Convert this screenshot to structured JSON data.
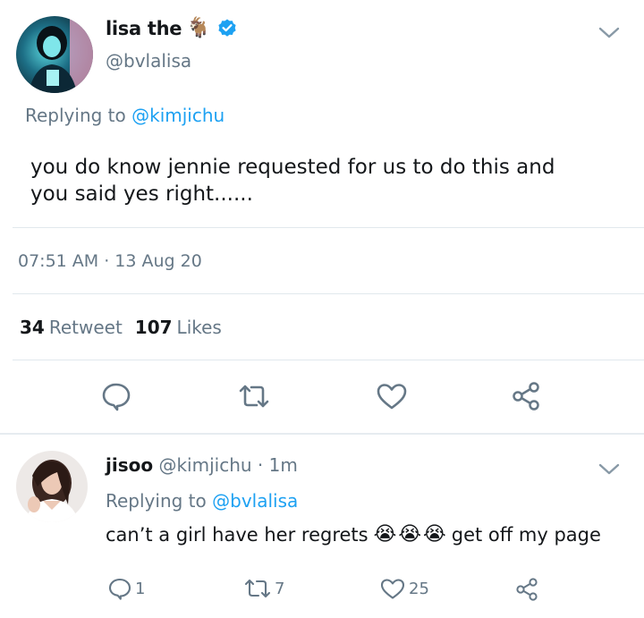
{
  "main_tweet": {
    "display_name": "lisa the",
    "name_emoji": "🐐",
    "handle": "@bvlalisa",
    "replying_prefix": "Replying to",
    "replying_handle": "@kimjichu",
    "text_line1": "you do know jennie requested for us to do this and",
    "text_line2": "you said yes right......",
    "timestamp": "07:51 AM · 13 Aug 20",
    "retweet_count": "34",
    "retweet_label": "Retweet",
    "likes_count": "107",
    "likes_label": "Likes",
    "icons": [
      "reply-icon",
      "retweet-icon",
      "like-icon",
      "share-icon"
    ]
  },
  "reply": {
    "display_name": "jisoo",
    "handle": "@kimjichu",
    "time": "· 1m",
    "replying_prefix": "Replying to",
    "replying_handle": "@bvlalisa",
    "text_before": "can’t a girl have her regrets",
    "emojis": [
      "😭",
      "😭",
      "😭"
    ],
    "text_after": "get off my page",
    "reply_count": "1",
    "retweet_count": "7",
    "like_count": "25"
  },
  "colors": {
    "link": "#1da1f2",
    "secondary_text": "#657786",
    "primary_text": "#14171a",
    "divider": "#e1e8ed",
    "icon": "#657786"
  }
}
